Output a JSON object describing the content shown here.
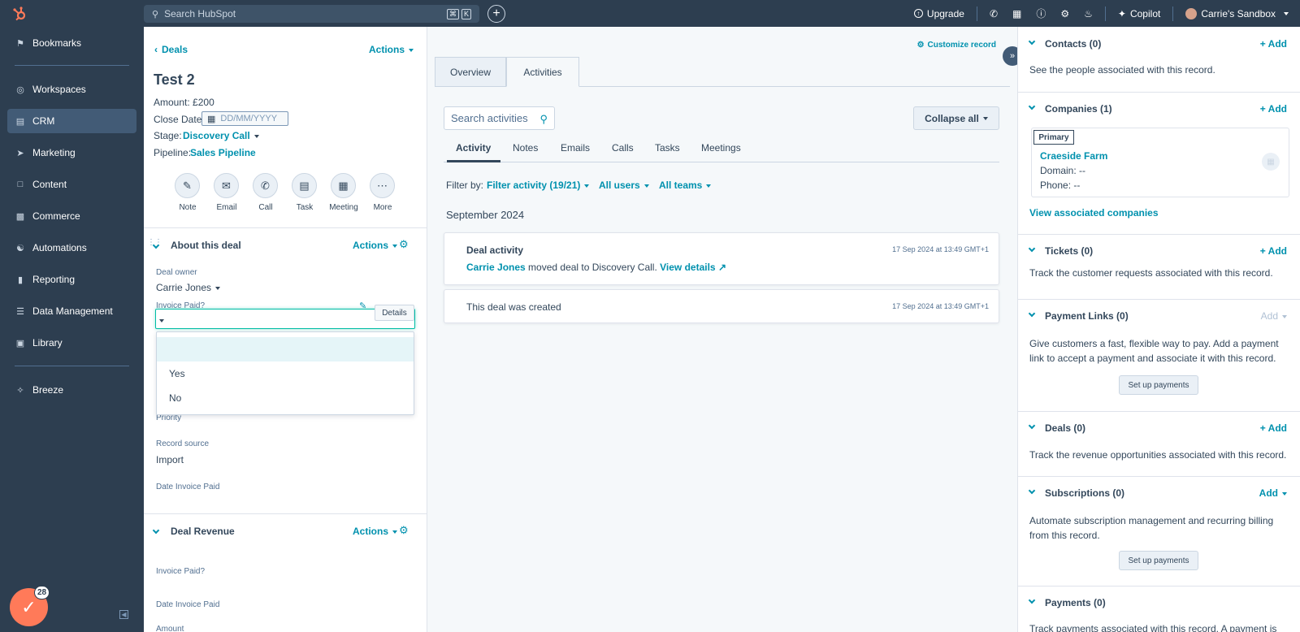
{
  "topbar": {
    "search_placeholder": "Search HubSpot",
    "kbd": [
      "⌘",
      "K"
    ],
    "upgrade": "Upgrade",
    "copilot": "Copilot",
    "account": "Carrie's Sandbox"
  },
  "sidebar": {
    "items": [
      {
        "label": "Bookmarks",
        "icon": "bookmark-icon"
      },
      {
        "label": "Workspaces",
        "icon": "workspaces-icon"
      },
      {
        "label": "CRM",
        "icon": "crm-icon"
      },
      {
        "label": "Marketing",
        "icon": "marketing-icon"
      },
      {
        "label": "Content",
        "icon": "content-icon"
      },
      {
        "label": "Commerce",
        "icon": "commerce-icon"
      },
      {
        "label": "Automations",
        "icon": "automations-icon"
      },
      {
        "label": "Reporting",
        "icon": "reporting-icon"
      },
      {
        "label": "Data Management",
        "icon": "data-icon"
      },
      {
        "label": "Library",
        "icon": "library-icon"
      },
      {
        "label": "Breeze",
        "icon": "breeze-icon"
      }
    ],
    "notification_count": "28"
  },
  "record": {
    "back_label": "Deals",
    "actions_label": "Actions",
    "title": "Test 2",
    "amount_label": "Amount:",
    "amount_value": "£200",
    "close_date_label": "Close Date:",
    "close_date_placeholder": "DD/MM/YYYY",
    "stage_label": "Stage:",
    "stage_value": "Discovery Call",
    "pipeline_label": "Pipeline:",
    "pipeline_value": "Sales Pipeline",
    "activity_buttons": [
      "Note",
      "Email",
      "Call",
      "Task",
      "Meeting",
      "More"
    ]
  },
  "about": {
    "title": "About this deal",
    "actions_label": "Actions",
    "deal_owner_label": "Deal owner",
    "deal_owner_value": "Carrie Jones",
    "invoice_paid_label": "Invoice Paid?",
    "details_label": "Details",
    "dropdown_options": [
      "",
      "Yes",
      "No"
    ],
    "priority_label": "Priority",
    "record_source_label": "Record source",
    "record_source_value": "Import",
    "date_invoice_paid_label": "Date Invoice Paid"
  },
  "revenue": {
    "title": "Deal Revenue",
    "actions_label": "Actions",
    "invoice_paid_label": "Invoice Paid?",
    "date_invoice_paid_label": "Date Invoice Paid",
    "amount_label": "Amount"
  },
  "middle": {
    "customize": "Customize record",
    "tabs": [
      "Overview",
      "Activities"
    ],
    "search_placeholder": "Search activities",
    "collapse_all": "Collapse all",
    "subtabs": [
      "Activity",
      "Notes",
      "Emails",
      "Calls",
      "Tasks",
      "Meetings"
    ],
    "filter_by": "Filter by:",
    "filter_activity": "Filter activity (19/21)",
    "all_users": "All users",
    "all_teams": "All teams",
    "month": "September 2024",
    "activity_card": {
      "title": "Deal activity",
      "timestamp": "17 Sep 2024 at 13:49 GMT+1",
      "actor": "Carrie Jones",
      "text": "moved deal to Discovery Call.",
      "link": "View details"
    },
    "created_card": {
      "text": "This deal was created",
      "timestamp": "17 Sep 2024 at 13:49 GMT+1"
    }
  },
  "right": {
    "contacts": {
      "title": "Contacts (0)",
      "add": "+ Add",
      "text": "See the people associated with this record."
    },
    "companies": {
      "title": "Companies (1)",
      "add": "+ Add",
      "primary": "Primary",
      "company_name": "Craeside Farm",
      "domain": "Domain: --",
      "phone": "Phone: --",
      "view_all": "View associated companies"
    },
    "tickets": {
      "title": "Tickets (0)",
      "add": "+ Add",
      "text": "Track the customer requests associated with this record."
    },
    "payment_links": {
      "title": "Payment Links (0)",
      "add": "Add",
      "text": "Give customers a fast, flexible way to pay. Add a payment link to accept a payment and associate it with this record.",
      "button": "Set up payments"
    },
    "deals": {
      "title": "Deals (0)",
      "add": "+ Add",
      "text": "Track the revenue opportunities associated with this record."
    },
    "subscriptions": {
      "title": "Subscriptions (0)",
      "add": "Add",
      "text": "Automate subscription management and recurring billing from this record.",
      "button": "Set up payments"
    },
    "payments": {
      "title": "Payments (0)",
      "text": "Track payments associated with this record. A payment is"
    }
  },
  "colors": {
    "accent": "#0091ae",
    "nav": "#2d3e50",
    "fab": "#ff7a59",
    "focus": "#00bda5"
  }
}
